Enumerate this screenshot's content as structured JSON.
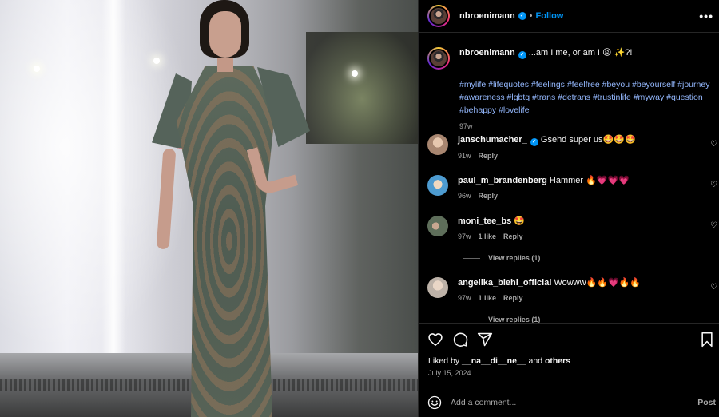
{
  "post": {
    "username": "nbroenimann",
    "follow_label": "Follow",
    "dot": "•",
    "more": "•••",
    "caption": "...am I me, or am I 😝 ✨?!",
    "hashtags": "#mylife #lifequotes #feelings #feelfree #beyou #beyourself #journey #awareness #lgbtq #trans #detrans #trustinlife #myway #question #behappy #lovelife",
    "caption_age": "97w"
  },
  "comments": [
    {
      "user": "janschumacher_",
      "text": "Gsehd super us🤩🤩🤩",
      "age": "91w",
      "likes": "",
      "reply": "Reply",
      "avatar_color": "#c8a98f"
    },
    {
      "user": "paul_m_brandenberg",
      "text": "Hammer 🔥💗💗💗",
      "age": "96w",
      "likes": "",
      "reply": "Reply",
      "avatar_color": "#5aa0c8"
    },
    {
      "user": "moni_tee_bs",
      "text": "🤩",
      "age": "97w",
      "likes": "1 like",
      "reply": "Reply",
      "avatar_color": "#6e7f6a"
    },
    {
      "user": "angelika_biehl_official",
      "text": "Wowww🔥🔥💗🔥🔥",
      "age": "97w",
      "likes": "1 like",
      "reply": "Reply",
      "avatar_color": "#d8d0c8"
    }
  ],
  "view_replies": [
    "View replies (1)",
    "View replies (1)"
  ],
  "actions": {
    "heart_icon": "heart-icon",
    "comment_icon": "comment-icon",
    "share_icon": "share-icon",
    "save_icon": "bookmark-icon"
  },
  "likes": {
    "prefix": "Liked by ",
    "user": "__na__di__ne__",
    "middle": " and ",
    "others": "others"
  },
  "date": "July 15, 2024",
  "add_comment": {
    "placeholder": "Add a comment...",
    "post_label": "Post"
  },
  "colors": {
    "accent": "#0095f6",
    "hashtag": "#95b9ff",
    "muted": "#a8a8a8"
  }
}
